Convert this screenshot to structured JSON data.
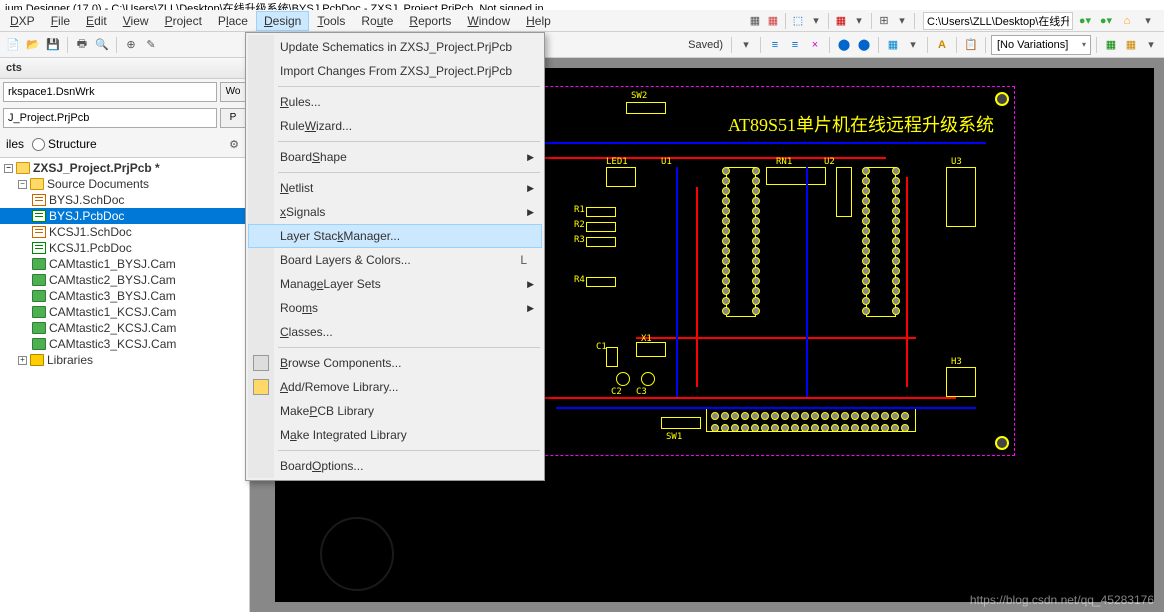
{
  "title_bar": "ium Designer (17.0) - C:\\Users\\ZLL\\Desktop\\在线升级系统\\BYSJ.PcbDoc - ZXSJ_Project.PrjPcb. Not signed in.",
  "menu": {
    "items": [
      "DXP",
      "File",
      "Edit",
      "View",
      "Project",
      "Place",
      "Design",
      "Tools",
      "Route",
      "Reports",
      "Window",
      "Help"
    ],
    "path_value": "C:\\Users\\ZLL\\Desktop\\在线升级"
  },
  "toolbar2": {
    "saved_text": "Saved)",
    "variations": "[No Variations]"
  },
  "panel": {
    "title": "cts",
    "workspace": "rkspace1.DsnWrk",
    "workspace_btn": "Wo",
    "project": "J_Project.PrjPcb",
    "project_btn": "P",
    "opt_files": "iles",
    "opt_structure": "Structure"
  },
  "tree": {
    "root": "ZXSJ_Project.PrjPcb *",
    "source_docs": "Source Documents",
    "files": [
      {
        "name": "BYSJ.SchDoc",
        "type": "sch"
      },
      {
        "name": "BYSJ.PcbDoc",
        "type": "pcb",
        "selected": true
      },
      {
        "name": "KCSJ1.SchDoc",
        "type": "sch"
      },
      {
        "name": "KCSJ1.PcbDoc",
        "type": "pcb"
      },
      {
        "name": "CAMtastic1_BYSJ.Cam",
        "type": "cam"
      },
      {
        "name": "CAMtastic2_BYSJ.Cam",
        "type": "cam"
      },
      {
        "name": "CAMtastic3_BYSJ.Cam",
        "type": "cam"
      },
      {
        "name": "CAMtastic1_KCSJ.Cam",
        "type": "cam"
      },
      {
        "name": "CAMtastic2_KCSJ.Cam",
        "type": "cam"
      },
      {
        "name": "CAMtastic3_KCSJ.Cam",
        "type": "cam"
      }
    ],
    "libraries": "Libraries"
  },
  "design_menu": [
    {
      "label": "Update Schematics in ZXSJ_Project.PrjPcb",
      "u": ""
    },
    {
      "label": "Import Changes From ZXSJ_Project.PrjPcb",
      "u": ""
    },
    {
      "sep": true
    },
    {
      "label": "Rules...",
      "u": "R"
    },
    {
      "label": "Rule Wizard...",
      "u": "W"
    },
    {
      "sep": true
    },
    {
      "label": "Board Shape",
      "u": "S",
      "arrow": true
    },
    {
      "sep": true
    },
    {
      "label": "Netlist",
      "u": "N",
      "arrow": true
    },
    {
      "label": "xSignals",
      "u": "x",
      "arrow": true
    },
    {
      "label": "Layer Stack Manager...",
      "u": "k",
      "highlighted": true
    },
    {
      "label": "Board Layers & Colors...",
      "u": "",
      "shortcut": "L"
    },
    {
      "label": "Manage Layer Sets",
      "u": "e",
      "arrow": true
    },
    {
      "label": "Rooms",
      "u": "m",
      "arrow": true
    },
    {
      "label": "Classes...",
      "u": "C"
    },
    {
      "sep": true
    },
    {
      "label": "Browse Components...",
      "u": "B",
      "icon": "comp"
    },
    {
      "label": "Add/Remove Library...",
      "u": "A",
      "icon": "lib"
    },
    {
      "label": "Make PCB Library",
      "u": "P"
    },
    {
      "label": "Make Integrated Library",
      "u": "a"
    },
    {
      "sep": true
    },
    {
      "label": "Board Options...",
      "u": "O"
    }
  ],
  "pcb": {
    "title": "AT89S51单片机在线远程升级系统",
    "labels": [
      "SW2",
      "SW1",
      "LED1",
      "X1",
      "C1",
      "C2",
      "C3",
      "R1",
      "R2",
      "R3",
      "R4",
      "U1",
      "U2",
      "U3",
      "RN1",
      "H3"
    ]
  },
  "watermark": "https://blog.csdn.net/qq_45283176"
}
